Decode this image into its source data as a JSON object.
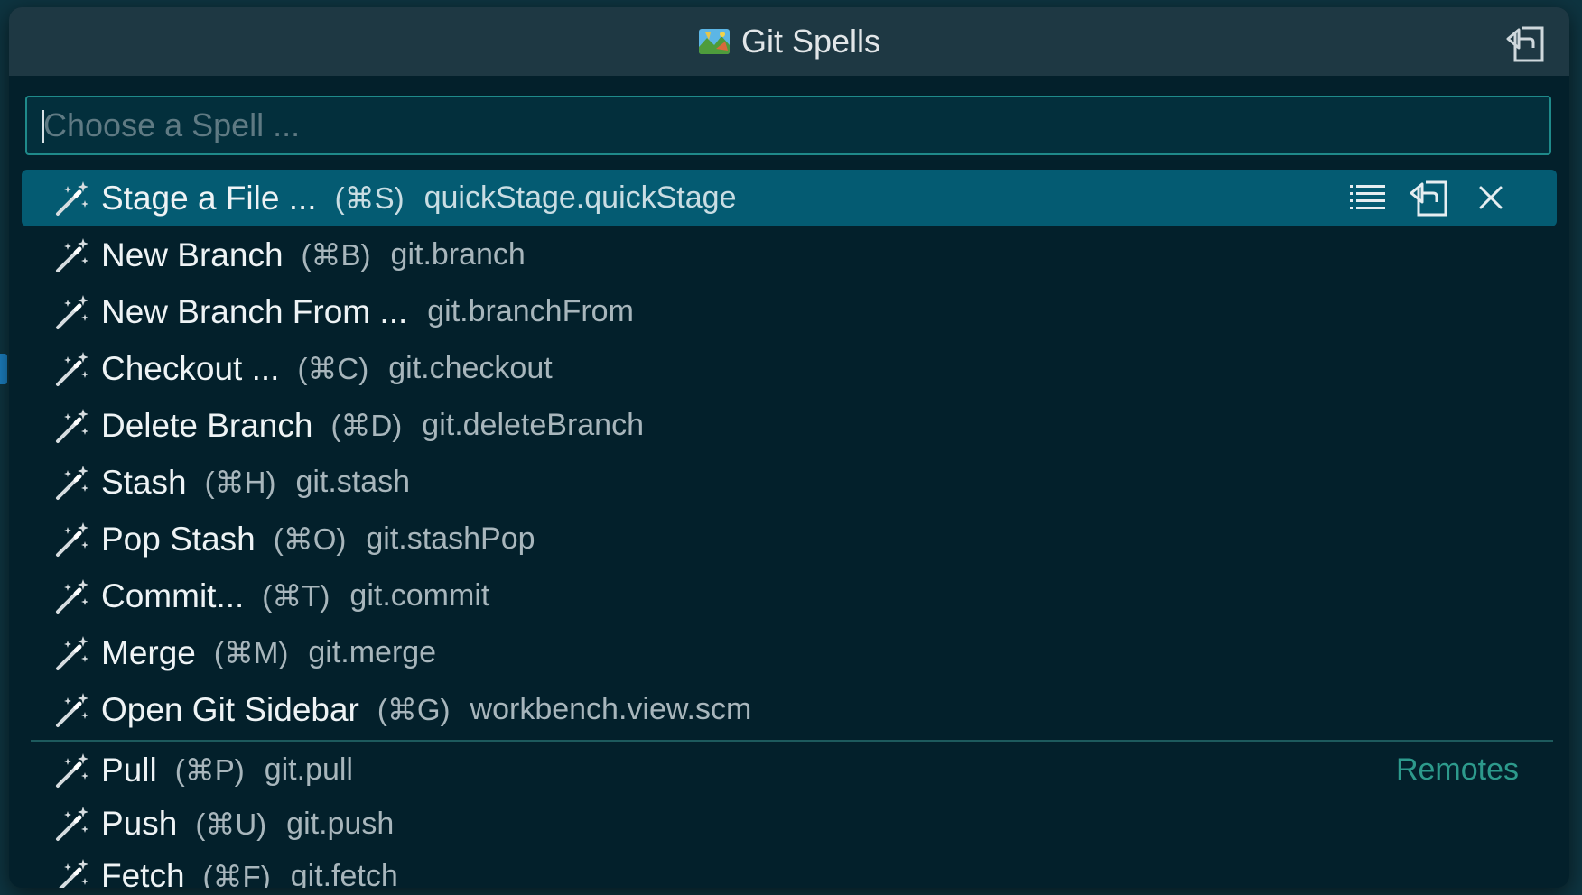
{
  "palette": {
    "title": "Git Spells",
    "title_emoji": "map-emoji",
    "search_placeholder": "Choose a Spell ...",
    "search_value": ""
  },
  "items": [
    {
      "label": "Stage a File ...",
      "key": "(⌘S)",
      "command": "quickStage.quickStage",
      "selected": true
    },
    {
      "label": "New Branch",
      "key": "(⌘B)",
      "command": "git.branch"
    },
    {
      "label": "New Branch From ...",
      "key": "",
      "command": "git.branchFrom"
    },
    {
      "label": "Checkout ...",
      "key": "(⌘C)",
      "command": "git.checkout"
    },
    {
      "label": "Delete Branch",
      "key": "(⌘D)",
      "command": "git.deleteBranch"
    },
    {
      "label": "Stash",
      "key": "(⌘H)",
      "command": "git.stash"
    },
    {
      "label": "Pop Stash",
      "key": "(⌘O)",
      "command": "git.stashPop"
    },
    {
      "label": "Commit...",
      "key": "(⌘T)",
      "command": "git.commit"
    },
    {
      "label": "Merge",
      "key": "(⌘M)",
      "command": "git.merge"
    },
    {
      "label": "Open Git Sidebar",
      "key": "(⌘G)",
      "command": "workbench.view.scm"
    }
  ],
  "remotes_group": {
    "label": "Remotes",
    "items": [
      {
        "label": "Pull",
        "key": "(⌘P)",
        "command": "git.pull"
      },
      {
        "label": "Push",
        "key": "(⌘U)",
        "command": "git.push"
      },
      {
        "label": "Fetch",
        "key": "(⌘F)",
        "command": "git.fetch"
      }
    ]
  },
  "icons": {
    "item_icon": "magic-wand-icon",
    "list_action": "list-icon",
    "open_action": "open-in-editor-icon",
    "close_action": "close-icon"
  },
  "colors": {
    "selected_bg": "#045b72",
    "accent": "#2d9a8c",
    "search_border": "#1f8a8a"
  }
}
